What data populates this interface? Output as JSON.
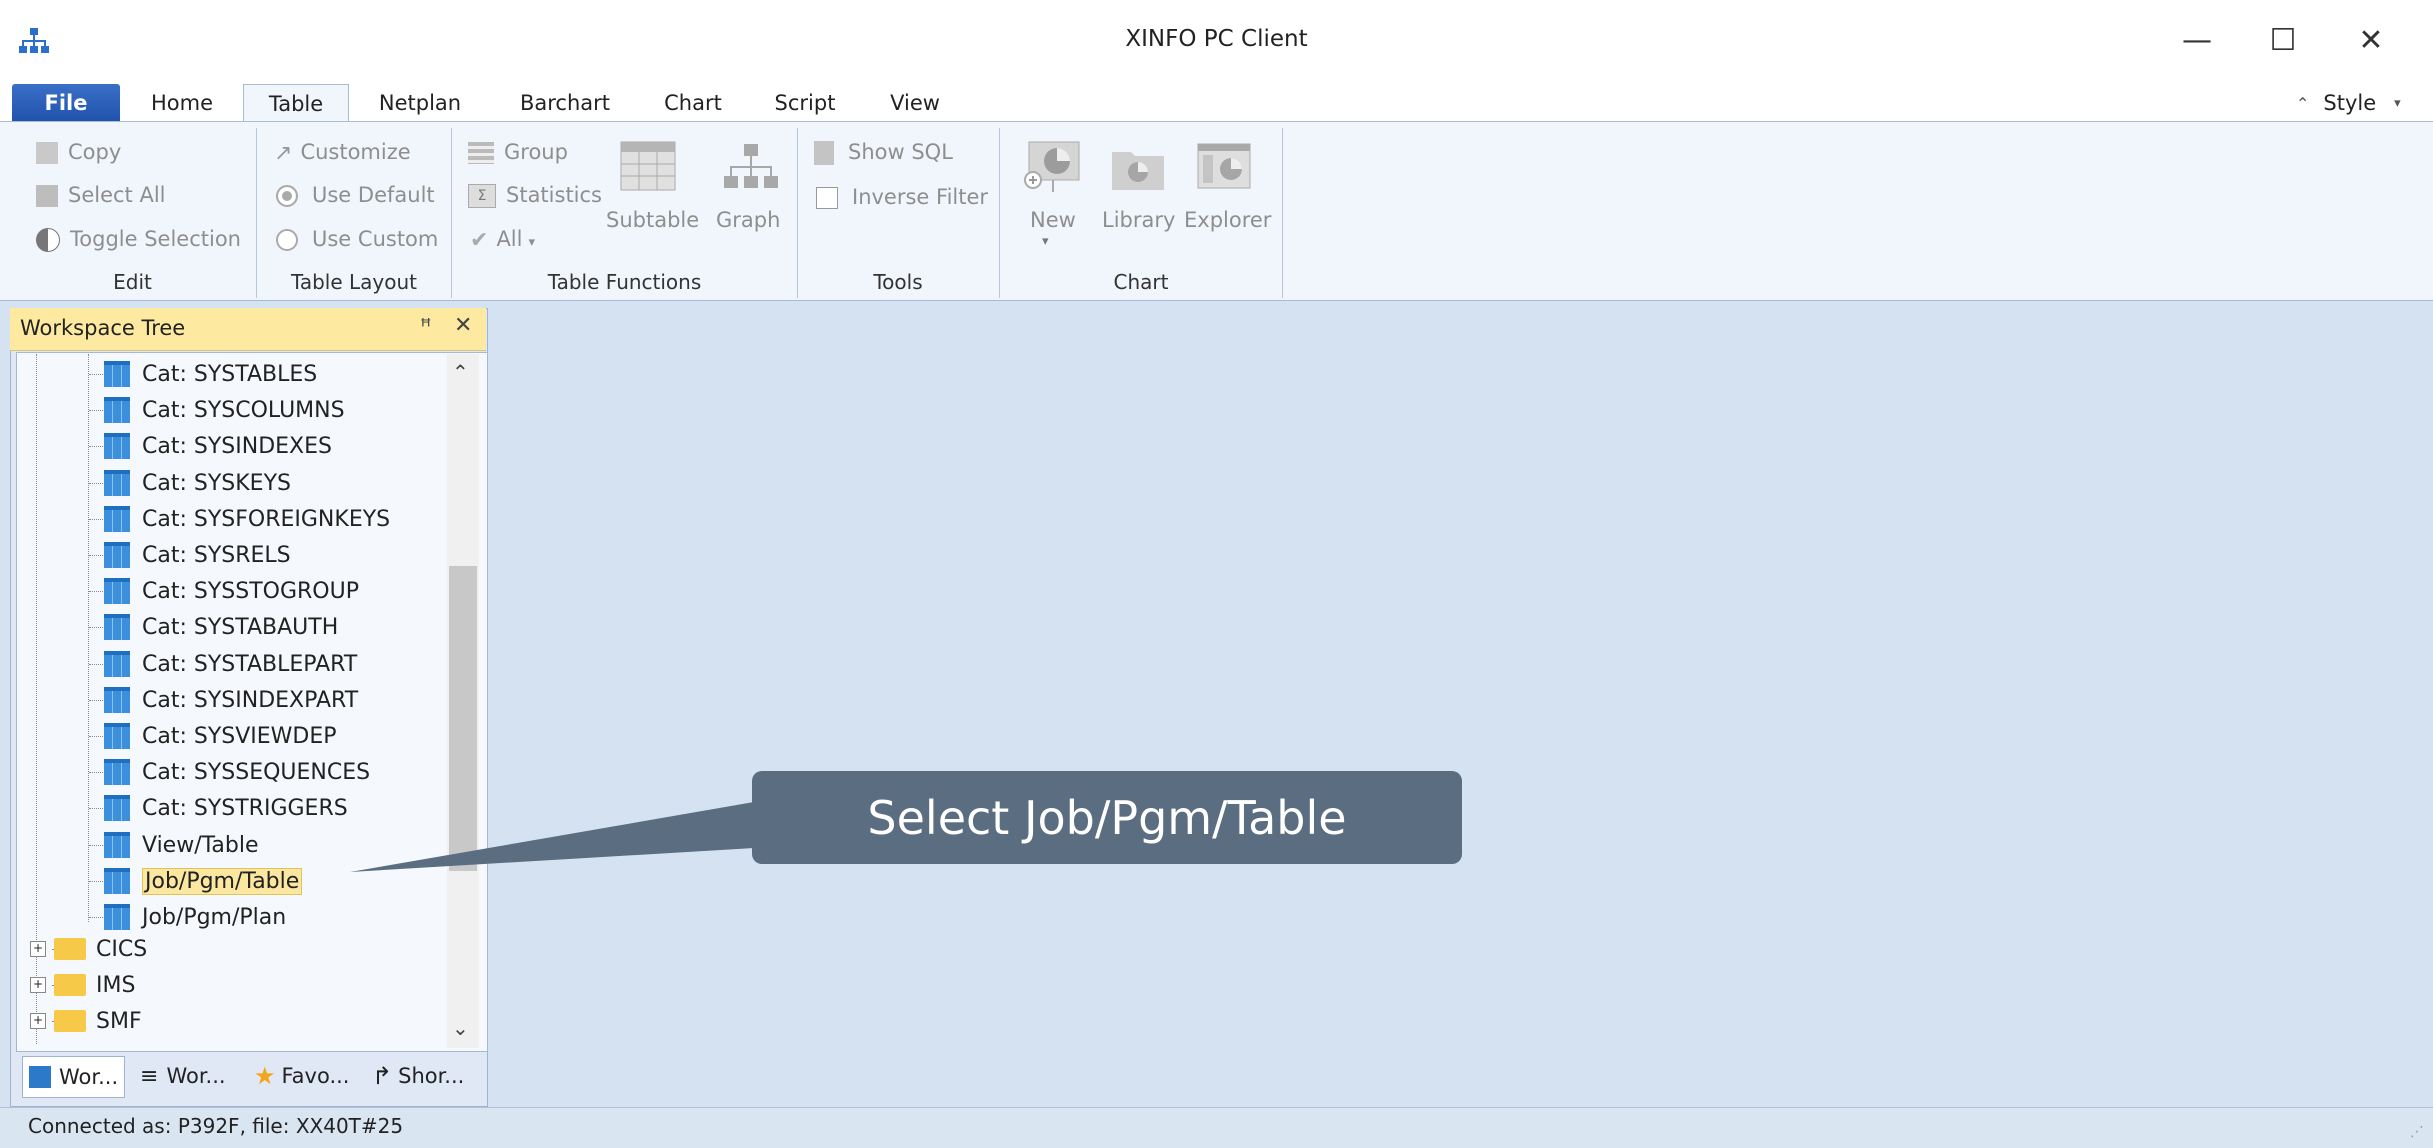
{
  "window": {
    "title": "XINFO PC Client",
    "minimize": "—",
    "maximize": "☐",
    "close": "✕"
  },
  "tabs": [
    "File",
    "Home",
    "Table",
    "Netplan",
    "Barchart",
    "Chart",
    "Script",
    "View"
  ],
  "style_menu": {
    "label": "Style"
  },
  "ribbon": {
    "edit": {
      "copy": "Copy",
      "select_all": "Select All",
      "toggle_selection": "Toggle Selection",
      "label": "Edit"
    },
    "table_layout": {
      "customize": "Customize",
      "use_default": "Use Default",
      "use_custom": "Use Custom",
      "label": "Table Layout"
    },
    "table_functions": {
      "group": "Group",
      "statistics": "Statistics",
      "all": "All",
      "subtable": "Subtable",
      "graph": "Graph",
      "label": "Table Functions"
    },
    "tools": {
      "show_sql": "Show SQL",
      "inverse_filter": "Inverse Filter",
      "label": "Tools"
    },
    "chart": {
      "new": "New",
      "library": "Library",
      "explorer": "Explorer",
      "label": "Chart"
    }
  },
  "workspace": {
    "title": "Workspace Tree",
    "pin": "ꟸ",
    "close": "✕",
    "items": [
      "Cat: SYSTABLES",
      "Cat: SYSCOLUMNS",
      "Cat: SYSINDEXES",
      "Cat: SYSKEYS",
      "Cat: SYSFOREIGNKEYS",
      "Cat: SYSRELS",
      "Cat: SYSSTOGROUP",
      "Cat: SYSTABAUTH",
      "Cat: SYSTABLEPART",
      "Cat: SYSINDEXPART",
      "Cat: SYSVIEWDEP",
      "Cat: SYSSEQUENCES",
      "Cat: SYSTRIGGERS",
      "View/Table",
      "Job/Pgm/Table",
      "Job/Pgm/Plan"
    ],
    "folders": [
      "CICS",
      "IMS",
      "SMF"
    ],
    "bottom_tabs": [
      "Wor...",
      "Wor...",
      "Favo...",
      "Shor..."
    ]
  },
  "callout": {
    "text": "Select  Job/Pgm/Table"
  },
  "status": {
    "text": "Connected as: P392F, file: XX40T#25"
  },
  "colors": {
    "accent": "#1f52ac",
    "selection": "#fce7a1",
    "callout": "#5b6d80",
    "ribbon_bg": "#f1f6fc"
  }
}
